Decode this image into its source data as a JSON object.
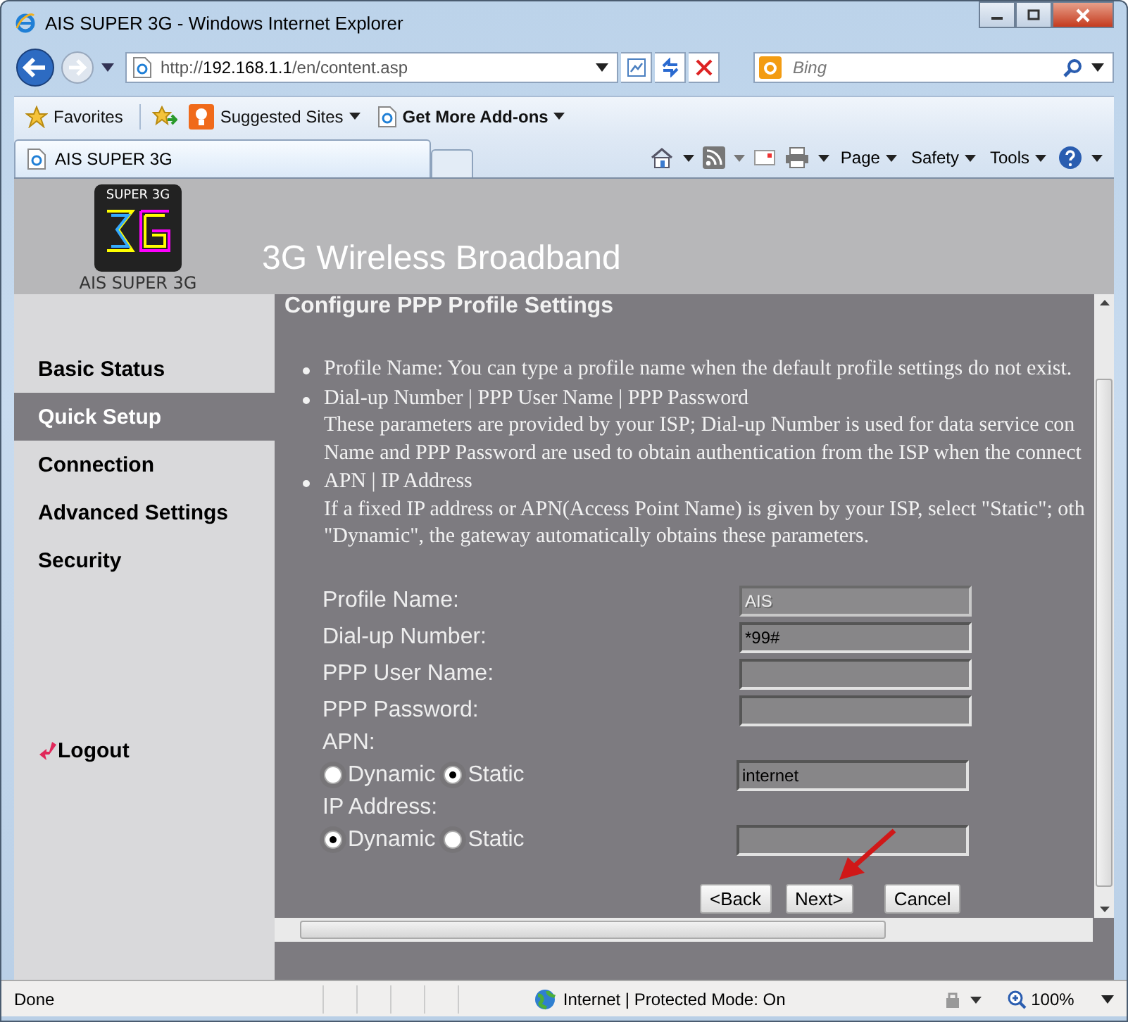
{
  "window": {
    "title": "AIS SUPER 3G - Windows Internet Explorer"
  },
  "address_bar": {
    "scheme": "http://",
    "host": "192.168.1.1",
    "path": "/en/content.asp"
  },
  "search": {
    "placeholder": "Bing"
  },
  "favorites_bar": [
    {
      "kind": "favorites",
      "label": "Favorites"
    },
    {
      "kind": "suggested",
      "label": "Suggested Sites"
    },
    {
      "kind": "addons",
      "label": "Get More Add-ons"
    }
  ],
  "tabs": [
    {
      "label": "AIS SUPER 3G",
      "selected": true
    }
  ],
  "command_bar": [
    "Page",
    "Safety",
    "Tools"
  ],
  "page": {
    "logo_text": "SUPER 3G",
    "logo_caption": "AIS SUPER 3G",
    "banner": "3G Wireless Broadband",
    "sidebar": [
      {
        "label": "Basic Status",
        "selected": false
      },
      {
        "label": "Quick Setup",
        "selected": true
      },
      {
        "label": "Connection",
        "selected": false
      },
      {
        "label": "Advanced Settings",
        "selected": false
      },
      {
        "label": "Security",
        "selected": false
      }
    ],
    "logout": "Logout",
    "heading": "Configure PPP Profile Settings",
    "help": [
      {
        "title": "Profile Name: You can type a profile name when the default profile settings do not exist."
      },
      {
        "title": "Dial-up Number | PPP User Name | PPP Password",
        "lines": [
          "These parameters are provided by your ISP; Dial-up Number is used for data service con",
          "Name and PPP Password are used to obtain authentication from the ISP when the connect"
        ]
      },
      {
        "title": "APN | IP Address",
        "lines": [
          "If a fixed IP address or APN(Access Point Name) is given by your ISP, select \"Static\"; oth",
          "\"Dynamic\", the gateway automatically obtains these parameters."
        ]
      }
    ],
    "fields": [
      {
        "kind": "text",
        "label": "Profile Name:",
        "value": "AIS",
        "disabled": true
      },
      {
        "kind": "text",
        "label": "Dial-up Number:",
        "value": "*99#",
        "disabled": false
      },
      {
        "kind": "text",
        "label": "PPP User Name:",
        "disabled": false
      },
      {
        "kind": "text",
        "label": "PPP Password:",
        "disabled": false
      },
      {
        "kind": "radio",
        "label": "APN:",
        "options": [
          {
            "label": "Dynamic",
            "selected": false
          },
          {
            "label": "Static",
            "selected": true
          }
        ],
        "value": "internet"
      },
      {
        "kind": "radio",
        "label": "IP Address:",
        "options": [
          {
            "label": "Dynamic",
            "selected": true
          },
          {
            "label": "Static",
            "selected": false
          }
        ]
      }
    ],
    "buttons": [
      "<Back",
      "Next>",
      "Cancel"
    ]
  },
  "status_bar": {
    "text": "Done",
    "zone": "Internet | Protected Mode: On",
    "zoom": "100%"
  }
}
